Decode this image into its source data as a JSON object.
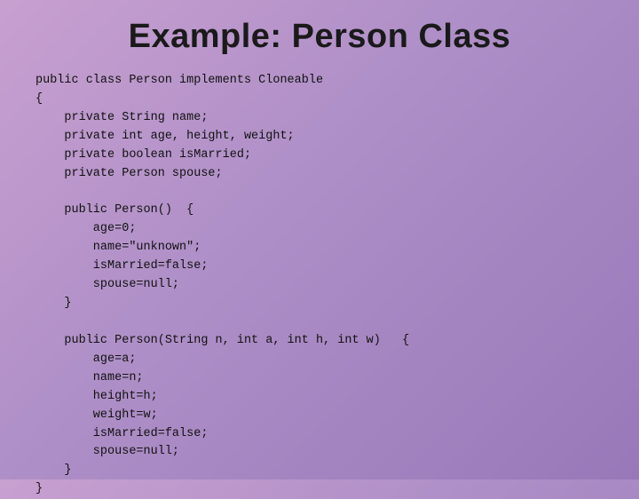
{
  "slide": {
    "title": "Example:  Person Class",
    "code": "public class Person implements Cloneable\n{\n    private String name;\n    private int age, height, weight;\n    private boolean isMarried;\n    private Person spouse;\n\n    public Person()  {\n        age=0;\n        name=\"unknown\";\n        isMarried=false;\n        spouse=null;\n    }\n\n    public Person(String n, int a, int h, int w)   {\n        age=a;\n        name=n;\n        height=h;\n        weight=w;\n        isMarried=false;\n        spouse=null;\n    }\n}"
  }
}
